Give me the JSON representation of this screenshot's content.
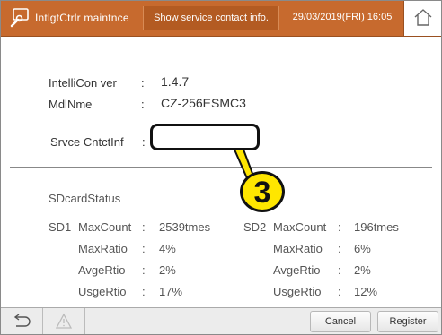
{
  "header": {
    "title": "IntlgtCtrlr maintnce",
    "center_label": "Show service contact info.",
    "datetime": "29/03/2019(FRI) 16:05",
    "app_icon": "wrench-icon",
    "home_icon": "home-icon"
  },
  "info": {
    "ver_label": "IntelliCon ver",
    "ver_colon": ":",
    "ver_value": "1.4.7",
    "model_label": "MdlNme",
    "model_colon": ":",
    "model_value": "CZ-256ESMC3",
    "contact_label": "Srvce CntctInf",
    "contact_colon": ":",
    "contact_value": ""
  },
  "callout": {
    "number": "3",
    "color": "#ffe600"
  },
  "sdcard": {
    "title": "SDcardStatus",
    "sd1": {
      "name": "SD1",
      "rows": [
        {
          "label": "MaxCount",
          "colon": ":",
          "value": "2539tmes"
        },
        {
          "label": "MaxRatio",
          "colon": ":",
          "value": "4%"
        },
        {
          "label": "AvgeRtio",
          "colon": ":",
          "value": "2%"
        },
        {
          "label": "UsgeRtio",
          "colon": ":",
          "value": "17%"
        }
      ]
    },
    "sd2": {
      "name": "SD2",
      "rows": [
        {
          "label": "MaxCount",
          "colon": ":",
          "value": "196tmes"
        },
        {
          "label": "MaxRatio",
          "colon": ":",
          "value": "6%"
        },
        {
          "label": "AvgeRtio",
          "colon": ":",
          "value": "2%"
        },
        {
          "label": "UsgeRtio",
          "colon": ":",
          "value": "12%"
        }
      ]
    }
  },
  "footer": {
    "back_icon": "back-arrow-icon",
    "warning_icon": "warning-icon",
    "cancel_label": "Cancel",
    "register_label": "Register"
  },
  "colors": {
    "header": "#c76a2e",
    "header_center": "#b35b22"
  }
}
